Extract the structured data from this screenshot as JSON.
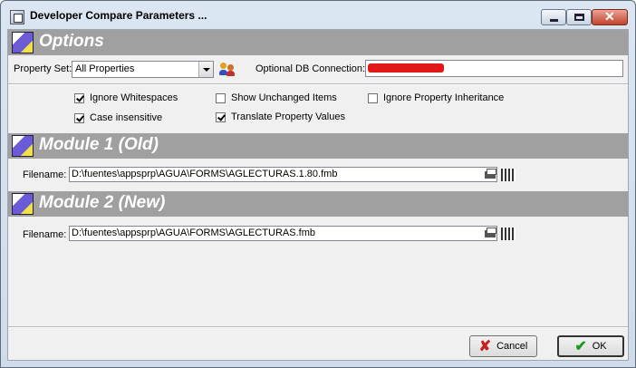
{
  "window": {
    "title": "Developer Compare Parameters ..."
  },
  "sections": {
    "options": "Options",
    "module1": "Module 1 (Old)",
    "module2": "Module 2 (New)"
  },
  "options": {
    "property_set_label": "Property Set:",
    "property_set_value": "All Properties",
    "db_connection_label": "Optional DB Connection:",
    "checkboxes": [
      {
        "label": "Ignore Whitespaces",
        "checked": true
      },
      {
        "label": "Show Unchanged Items",
        "checked": false
      },
      {
        "label": "Ignore Property Inheritance",
        "checked": false
      },
      {
        "label": "Case insensitive",
        "checked": true
      },
      {
        "label": "Translate Property Values",
        "checked": true
      }
    ]
  },
  "module1": {
    "filename_label": "Filename:",
    "filename": "D:\\fuentes\\appsprp\\AGUA\\FORMS\\AGLECTURAS.1.80.fmb"
  },
  "module2": {
    "filename_label": "Filename:",
    "filename": "D:\\fuentes\\appsprp\\AGUA\\FORMS\\AGLECTURAS.fmb"
  },
  "buttons": {
    "cancel": "Cancel",
    "ok": "OK"
  },
  "colors": {
    "section_bar": "#a0a0a0",
    "cancel_icon": "#c81e1e",
    "ok_icon": "#1c9a1c",
    "redaction": "#e01818"
  }
}
